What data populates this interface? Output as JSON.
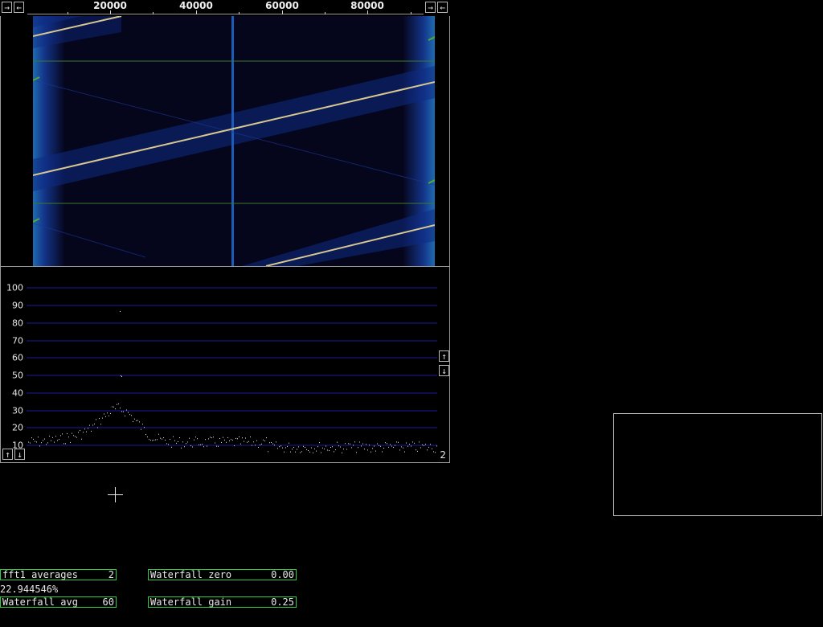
{
  "freq_axis": {
    "ticks": [
      "20000",
      "40000",
      "60000",
      "80000"
    ],
    "left_buttons": [
      "→",
      "←"
    ],
    "right_buttons": [
      "→",
      "←"
    ]
  },
  "spectrum": {
    "y_ticks": [
      "100",
      "90",
      "80",
      "70",
      "60",
      "50",
      "40",
      "30",
      "20",
      "10"
    ],
    "scale_up": "↑",
    "scale_down": "↓",
    "avg_count_label": "2",
    "colors": {
      "grid": "#1a1aa0",
      "dots": "#e8e8e8"
    }
  },
  "waterfall": {
    "colors": {
      "background": "#05051c",
      "edge": "#1e4fa8",
      "signal": "#f0e0a0",
      "marker": "#55aa33"
    }
  },
  "params": {
    "fft1_averages": {
      "label": "fft1 averages",
      "value": "2"
    },
    "waterfall_avg": {
      "label": "Waterfall avg",
      "value": "60"
    },
    "waterfall_zero": {
      "label": "Waterfall zero",
      "value": "0.00"
    },
    "waterfall_gain": {
      "label": "Waterfall gain",
      "value": "0.25"
    }
  },
  "status": {
    "percent": "22.944546%"
  }
}
